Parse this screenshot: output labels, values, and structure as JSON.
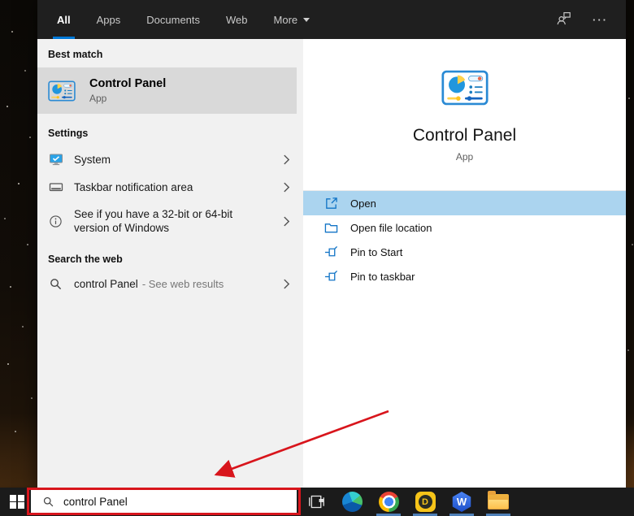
{
  "topbar": {
    "tabs": [
      {
        "label": "All",
        "active": true
      },
      {
        "label": "Apps",
        "active": false
      },
      {
        "label": "Documents",
        "active": false
      },
      {
        "label": "Web",
        "active": false
      },
      {
        "label": "More",
        "active": false,
        "has_dropdown": true
      }
    ],
    "right_icons": [
      "user-account-icon",
      "more-options-icon"
    ]
  },
  "search_flyout": {
    "best_match": {
      "header": "Best match",
      "result": {
        "title": "Control Panel",
        "type": "App",
        "icon": "control-panel-icon"
      }
    },
    "settings": {
      "header": "Settings",
      "items": [
        {
          "label": "System",
          "icon": "system-monitor-icon"
        },
        {
          "label": "Taskbar notification area",
          "icon": "taskbar-rect-icon"
        },
        {
          "label": "See if you have a 32-bit or 64-bit version of Windows",
          "icon": "info-icon"
        }
      ]
    },
    "search_the_web": {
      "header": "Search the web",
      "item": {
        "query": "control Panel",
        "suffix": "- See web results",
        "icon": "search-icon"
      }
    },
    "preview": {
      "app_title": "Control Panel",
      "app_type": "App",
      "icon": "control-panel-icon",
      "actions": [
        {
          "label": "Open",
          "icon": "open-icon",
          "selected": true
        },
        {
          "label": "Open file location",
          "icon": "folder-outline-icon",
          "selected": false
        },
        {
          "label": "Pin to Start",
          "icon": "pin-icon",
          "selected": false
        },
        {
          "label": "Pin to taskbar",
          "icon": "pin-icon",
          "selected": false
        }
      ]
    }
  },
  "taskbar": {
    "search_value": "control Panel",
    "buttons": [
      "start-button",
      "task-view-button"
    ],
    "pinned_apps": [
      "microsoft-edge-icon",
      "google-chrome-icon",
      "d-letter-app-icon",
      "wps-office-icon",
      "file-explorer-icon"
    ],
    "running_indicator_apps": [
      "google-chrome-icon",
      "d-letter-app-icon",
      "wps-office-icon",
      "file-explorer-icon"
    ]
  },
  "annotations": {
    "red_box_target": "taskbar search box",
    "red_arrow_target": "taskbar search box",
    "color": "#d8151c"
  },
  "colors": {
    "accent_blue": "#0078d7",
    "selected_action_bg": "#abd4ef",
    "best_match_bg": "#d9d9d9",
    "left_panel_bg": "#f1f1f1",
    "topbar_bg": "#1f1f1f",
    "taskbar_bg": "#1b1b1b",
    "annotation_red": "#d8151c"
  }
}
